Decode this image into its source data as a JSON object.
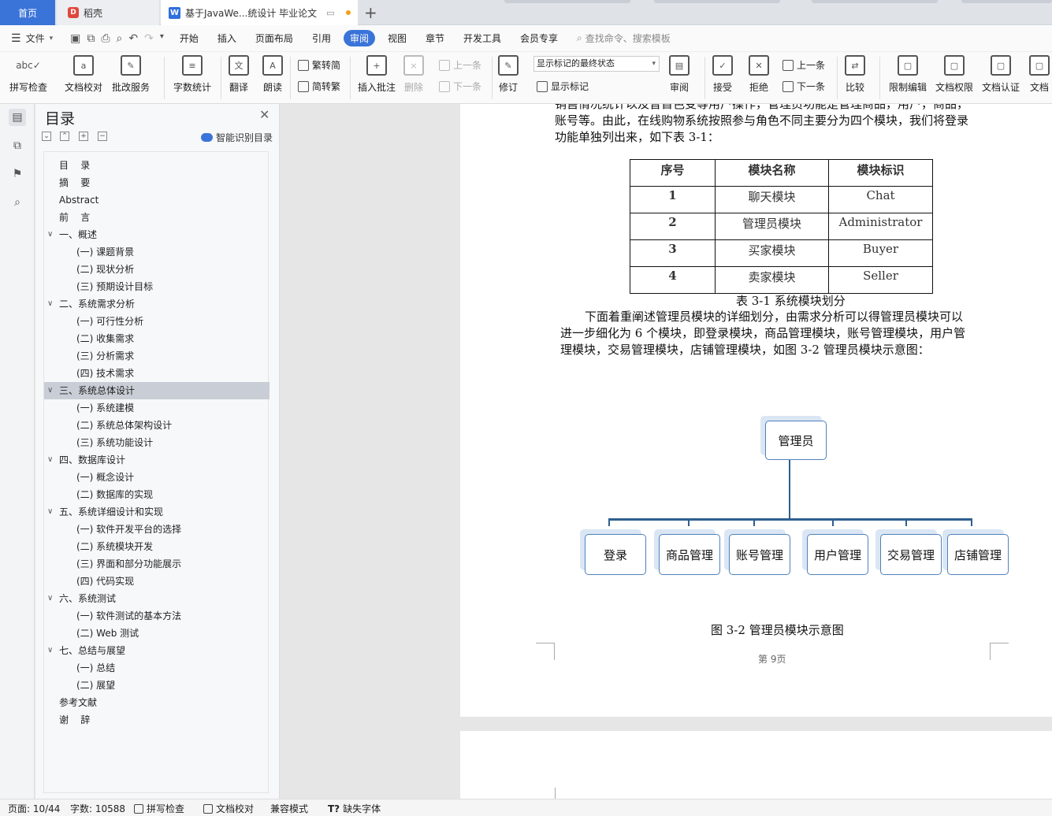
{
  "tabs": {
    "home": "首页",
    "daoke": "稻壳",
    "doc": "基于JavaWe...统设计 毕业论文",
    "add": "+"
  },
  "menu": {
    "file": "文件",
    "items": [
      "开始",
      "插入",
      "页面布局",
      "引用",
      "审阅",
      "视图",
      "章节",
      "开发工具",
      "会员专享"
    ],
    "active": "审阅",
    "search_placeholder": "查找命令、搜索模板"
  },
  "ribbon": {
    "spell_check": "拼写检查",
    "doc_proof": "文档校对",
    "batch_service": "批改服务",
    "word_count": "字数统计",
    "translate": "翻译",
    "read_aloud": "朗读",
    "trad_to_simp": "繁转简",
    "simp_to_trad": "简转繁",
    "insert_comment": "插入批注",
    "delete": "删除",
    "prev_comment": "上一条",
    "next_comment": "下一条",
    "track_changes": "修订",
    "markup_state": "显示标记的最终状态",
    "show_markup": "显示标记",
    "review": "审阅",
    "accept": "接受",
    "reject": "拒绝",
    "prev_change": "上一条",
    "next_change": "下一条",
    "compare": "比较",
    "restrict_edit": "限制编辑",
    "doc_permission": "文档权限",
    "doc_cert": "文档认证",
    "doc_more": "文档"
  },
  "nav": {
    "title": "目录",
    "smart_toc": "智能识别目录",
    "items": [
      {
        "label": "目    录",
        "level": 0
      },
      {
        "label": "摘    要",
        "level": 0
      },
      {
        "label": "Abstract",
        "level": 0
      },
      {
        "label": "前    言",
        "level": 0
      },
      {
        "label": "一、概述",
        "level": 0,
        "expanded": true
      },
      {
        "label": "(一) 课题背景",
        "level": 1
      },
      {
        "label": "(二) 现状分析",
        "level": 1
      },
      {
        "label": "(三) 预期设计目标",
        "level": 1
      },
      {
        "label": "二、系统需求分析",
        "level": 0,
        "expanded": true
      },
      {
        "label": "(一) 可行性分析",
        "level": 1
      },
      {
        "label": "(二) 收集需求",
        "level": 1
      },
      {
        "label": "(三) 分析需求",
        "level": 1
      },
      {
        "label": "(四) 技术需求",
        "level": 1
      },
      {
        "label": "三、系统总体设计",
        "level": 0,
        "expanded": true,
        "selected": true
      },
      {
        "label": "(一) 系统建模",
        "level": 1
      },
      {
        "label": "(二) 系统总体架构设计",
        "level": 1
      },
      {
        "label": "(三) 系统功能设计",
        "level": 1
      },
      {
        "label": "四、数据库设计",
        "level": 0,
        "expanded": true
      },
      {
        "label": "(一) 概念设计",
        "level": 1
      },
      {
        "label": "(二) 数据库的实现",
        "level": 1
      },
      {
        "label": "五、系统详细设计和实现",
        "level": 0,
        "expanded": true
      },
      {
        "label": "(一) 软件开发平台的选择",
        "level": 1
      },
      {
        "label": "(二) 系统模块开发",
        "level": 1
      },
      {
        "label": "(三) 界面和部分功能展示",
        "level": 1
      },
      {
        "label": "(四) 代码实现",
        "level": 1
      },
      {
        "label": "六、系统测试",
        "level": 0,
        "expanded": true
      },
      {
        "label": "(一) 软件测试的基本方法",
        "level": 1
      },
      {
        "label": "(二) Web 测试",
        "level": 1
      },
      {
        "label": "七、总结与展望",
        "level": 0,
        "expanded": true
      },
      {
        "label": "(一) 总结",
        "level": 1
      },
      {
        "label": "(二) 展望",
        "level": 1
      },
      {
        "label": "参考文献",
        "level": 0
      },
      {
        "label": "谢    辞",
        "level": 0
      }
    ]
  },
  "document": {
    "para1": [
      "销售情况统计以及曾首色变等用户操作，管理员功能是管理商品，用户，商品，",
      "账号等。由此，在线购物系统按照参与角色不同主要分为四个模块，我们将登录",
      "功能单独列出来，如下表 3-1："
    ],
    "table": {
      "headers": [
        "序号",
        "模块名称",
        "模块标识"
      ],
      "rows": [
        [
          "1",
          "聊天模块",
          "Chat"
        ],
        [
          "2",
          "管理员模块",
          "Administrator"
        ],
        [
          "3",
          "买家模块",
          "Buyer"
        ],
        [
          "4",
          "卖家模块",
          "Seller"
        ]
      ],
      "caption": "表 3-1  系统模块划分"
    },
    "para2": [
      "下面着重阐述管理员模块的详细划分，由需求分析可以得管理员模块可以",
      "进一步细化为 6 个模块，即登录模块，商品管理模块，账号管理模块，用户管",
      "理模块，交易管理模块，店铺管理模块，如图 3-2 管理员模块示意图："
    ],
    "diagram": {
      "root": "管理员",
      "children": [
        "登录",
        "商品管理",
        "账号管理",
        "用户管理",
        "交易管理",
        "店铺管理"
      ],
      "caption": "图 3-2  管理员模块示意图"
    },
    "page_footer": "第 9页"
  },
  "status": {
    "page": "页面: 10/44",
    "words": "字数: 10588",
    "spell_check": "拼写检查",
    "doc_proof": "文档校对",
    "compat_mode": "兼容模式",
    "missing_font": "缺失字体"
  }
}
